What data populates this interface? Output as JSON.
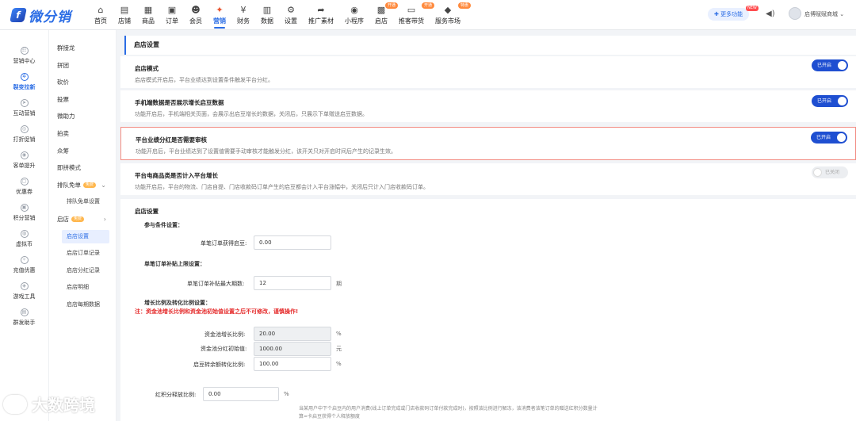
{
  "brand": {
    "logo_mark": "f",
    "name": "微分销"
  },
  "nav": [
    {
      "icon": "⌂",
      "label": "首页",
      "tag": ""
    },
    {
      "icon": "▤",
      "label": "店铺",
      "tag": ""
    },
    {
      "icon": "▦",
      "label": "商品",
      "tag": ""
    },
    {
      "icon": "▣",
      "label": "订单",
      "tag": ""
    },
    {
      "icon": "☻",
      "label": "会员",
      "tag": ""
    },
    {
      "icon": "✦",
      "label": "营销",
      "tag": ""
    },
    {
      "icon": "¥",
      "label": "财务",
      "tag": ""
    },
    {
      "icon": "▥",
      "label": "数据",
      "tag": ""
    },
    {
      "icon": "⚙",
      "label": "设置",
      "tag": ""
    },
    {
      "icon": "➦",
      "label": "推广素材",
      "tag": ""
    },
    {
      "icon": "◉",
      "label": "小程序",
      "tag": ""
    },
    {
      "icon": "▩",
      "label": "启店",
      "tag": "开通"
    },
    {
      "icon": "▭",
      "label": "推客带货",
      "tag": "开通"
    },
    {
      "icon": "◆",
      "label": "服务市场",
      "tag": "特惠"
    }
  ],
  "header": {
    "more_label": "✚ 更多功能",
    "new_tag": "NEW",
    "shop_name": "启博赋赋商城 ⌄"
  },
  "side1": [
    {
      "icon": "☷",
      "label": "营销中心"
    },
    {
      "icon": "✲",
      "label": "裂变拉新"
    },
    {
      "icon": "➤",
      "label": "互动营销"
    },
    {
      "icon": "◎",
      "label": "打折促销"
    },
    {
      "icon": "◉",
      "label": "客单提升"
    },
    {
      "icon": "▢",
      "label": "优惠券"
    },
    {
      "icon": "▣",
      "label": "积分营销"
    },
    {
      "icon": "◍",
      "label": "虚拟币"
    },
    {
      "icon": "✧",
      "label": "充值优惠"
    },
    {
      "icon": "◈",
      "label": "游戏工具"
    },
    {
      "icon": "▤",
      "label": "群发助手"
    }
  ],
  "side2": {
    "items": [
      "群接龙",
      "拼团",
      "砍价",
      "投票",
      "微助力",
      "拍卖",
      "众筹",
      "即拼模式"
    ],
    "queue": {
      "label": "排队免单",
      "tag": "免费"
    },
    "queue_sub": "排队免单设置",
    "store": {
      "label": "启店",
      "tag": "免费",
      "arrow": "›"
    },
    "store_subs": [
      "启店设置",
      "启店订单记录",
      "启店分红记录",
      "启店明细",
      "启店每期数据"
    ]
  },
  "page": {
    "title": "启店设置"
  },
  "rows": [
    {
      "title": "启店模式",
      "desc": "启店模式开启后，平台业绩达到设置条件触发平台分红。",
      "toggle": "已开启"
    },
    {
      "title": "手机端数据是否展示增长启豆数据",
      "desc": "功能开启后，手机端相关页面，会展示出启豆增长的数据，关闭后，只展示下单赠送启豆数据。",
      "toggle": "已开启"
    },
    {
      "title": "平台业绩分红是否需要审核",
      "desc": "功能开启后，平台业绩达到了设置值需要手动审核才能触发分红，该开关只对开启时间后产生的记录生效。",
      "toggle": "已开启"
    },
    {
      "title": "平台电商品类是否计入平台增长",
      "desc": "功能开启后，平台的物流、门店自提、门店收款码订单产生的启豆都会计入平台涨幅中，关闭后只计入门店收款码订单。",
      "toggle": "已关闭"
    }
  ],
  "settings": {
    "title": "启店设置",
    "participate_label": "参与条件设置：",
    "single_bean_label": "单笔订单获得启豆:",
    "single_bean_value": "0.00",
    "subsidy_label": "单笔订单补贴上限设置：",
    "subsidy_max_label": "单笔订单补贴最大期数:",
    "subsidy_max_value": "12",
    "subsidy_unit": "期",
    "growth_label": "增长比例及转化比例设置：",
    "warning": "注：资金池增长比例和资金池初始值设置之后不可修改，谨慎操作!",
    "pool_growth_label": "资金池增长比例:",
    "pool_growth_value": "20.00",
    "pool_growth_unit": "%",
    "pool_init_label": "资金池分红初始值:",
    "pool_init_value": "1000.00",
    "pool_init_unit": "元",
    "bean_convert_label": "启豆转余额转化比例:",
    "bean_convert_value": "100.00",
    "bean_convert_unit": "%",
    "dividend_label": "红积分释放比例:",
    "dividend_value": "0.00",
    "dividend_unit": "%",
    "note": "当某用户中下个启豆内的用户消费(线上订单完成或门店收款码订单付款完成时)，按照该比例进行解冻，该消费者该笔订单的赠送红积分数量计算=卡启豆获得个人释放额度"
  },
  "watermark": "大数跨境"
}
